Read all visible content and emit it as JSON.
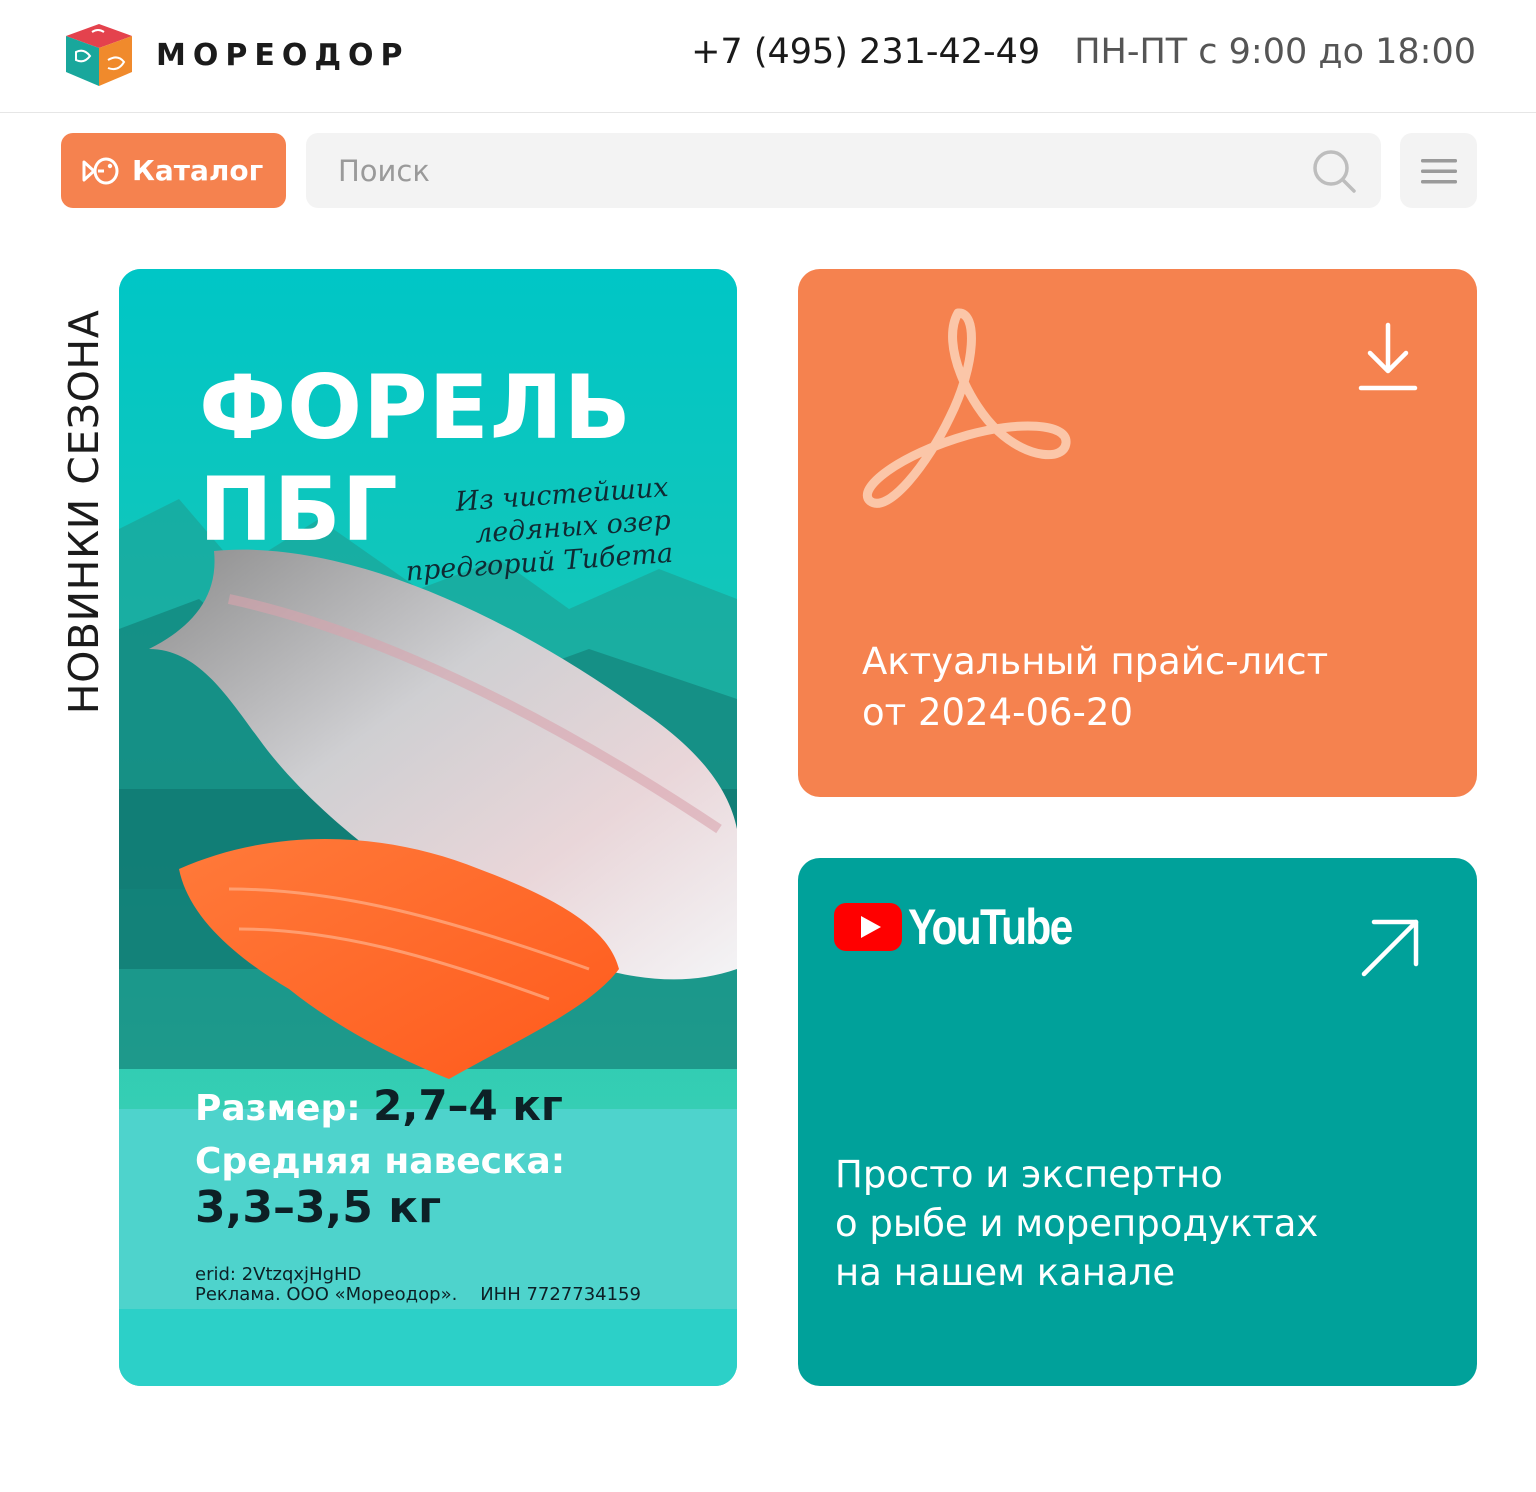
{
  "header": {
    "brand": "МОРЕОДОР",
    "phone": "+7 (495) 231-42-49",
    "hours": "ПН-ПТ с 9:00 до 18:00"
  },
  "toolbar": {
    "catalog_label": "Каталог",
    "search_placeholder": "Поиск"
  },
  "section": {
    "label": "НОВИНКИ СЕЗОНА"
  },
  "promo": {
    "title_line1": "ФОРЕЛЬ",
    "title_line2": "ПБГ",
    "subtitle": "Из чистейших ледяных озер предгорий Тибета",
    "size_label": "Размер:",
    "size_value": "2,7–4 кг",
    "avg_label": "Средняя навеска:",
    "avg_value": "3,3–3,5 кг",
    "erid": "erid: 2VtzqxjHgHD",
    "legal": "Реклама. ООО «Мореодор».    ИНН 7727734159"
  },
  "price_card": {
    "line1": "Актуальный прайс-лист",
    "line2": "от 2024-06-20",
    "icon": "pdf-icon",
    "action_icon": "download-icon"
  },
  "youtube_card": {
    "brand": "YouTube",
    "line1": "Просто и экспертно",
    "line2": "о рыбе и морепродуктах",
    "line3": "на нашем канале",
    "action_icon": "arrow-up-right-icon"
  },
  "colors": {
    "accent_orange": "#f5824f",
    "accent_teal": "#00a19a",
    "search_bg": "#f3f3f3"
  }
}
